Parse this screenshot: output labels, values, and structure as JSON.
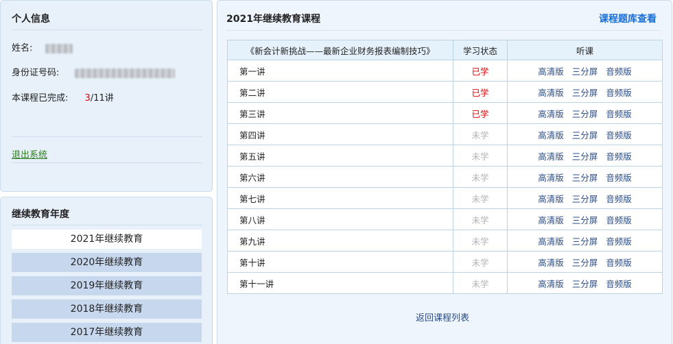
{
  "personal": {
    "title": "个人信息",
    "name_label": "姓名:",
    "id_label": "身份证号码:",
    "progress_label": "本课程已完成:",
    "progress_done": "3",
    "progress_total": "/11讲",
    "logout": "退出系统"
  },
  "years": {
    "title": "继续教育年度",
    "items": [
      {
        "label": "2021年继续教育",
        "active": true
      },
      {
        "label": "2020年继续教育",
        "active": false
      },
      {
        "label": "2019年继续教育",
        "active": false
      },
      {
        "label": "2018年继续教育",
        "active": false
      },
      {
        "label": "2017年继续教育",
        "active": false
      }
    ]
  },
  "course": {
    "title": "2021年继续教育课程",
    "bank_link": "课程题库查看",
    "table": {
      "headers": [
        "《新会计新挑战——最新企业财务报表编制技巧》",
        "学习状态",
        "听课"
      ],
      "link_labels": [
        "高清版",
        "三分屏",
        "音频版"
      ],
      "rows": [
        {
          "lesson": "第一讲",
          "status": "已学",
          "done": true
        },
        {
          "lesson": "第二讲",
          "status": "已学",
          "done": true
        },
        {
          "lesson": "第三讲",
          "status": "已学",
          "done": true
        },
        {
          "lesson": "第四讲",
          "status": "未学",
          "done": false
        },
        {
          "lesson": "第五讲",
          "status": "未学",
          "done": false
        },
        {
          "lesson": "第六讲",
          "status": "未学",
          "done": false
        },
        {
          "lesson": "第七讲",
          "status": "未学",
          "done": false
        },
        {
          "lesson": "第八讲",
          "status": "未学",
          "done": false
        },
        {
          "lesson": "第九讲",
          "status": "未学",
          "done": false
        },
        {
          "lesson": "第十讲",
          "status": "未学",
          "done": false
        },
        {
          "lesson": "第十一讲",
          "status": "未学",
          "done": false
        }
      ]
    },
    "back_link": "返回课程列表"
  },
  "colors": {
    "accent": "#1a6fd6",
    "done": "#e00000",
    "todo": "#b3b3b3",
    "logout": "#2e7d1e"
  }
}
